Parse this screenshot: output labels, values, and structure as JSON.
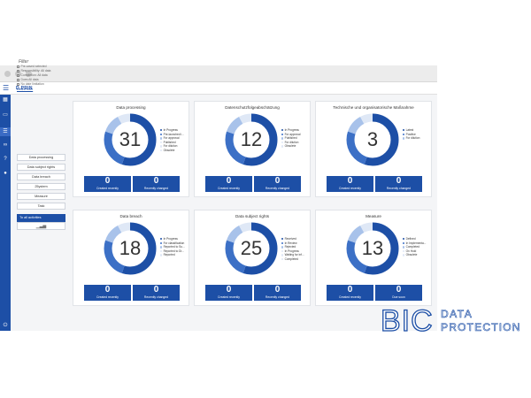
{
  "app": {
    "brand": "D.PRIN"
  },
  "colors": {
    "primary": "#1d4fa6",
    "mid": "#3c70c6",
    "light": "#a8c2ea",
    "pale": "#dfe8f6"
  },
  "sidebar": {
    "icons": [
      "grid-icon",
      "bar-chart-icon",
      "list-icon",
      "share-icon",
      "help-icon",
      "user-icon",
      "power-icon"
    ]
  },
  "filter": {
    "title": "Filter",
    "options": [
      "Pre-saved selected",
      "Responsibility: All data",
      "Completion: All data",
      "Does All data",
      "No date limitation"
    ],
    "define_link": "Define filter"
  },
  "categories": [
    "Data processing",
    "Data subject rights",
    "Data breach",
    "25ystem",
    "Measure",
    "Task"
  ],
  "all_activities": "To all activities",
  "cards": [
    {
      "title": "Data processing",
      "count": "31",
      "legend": [
        "In Progress",
        "Pre-launched i...",
        "For approval",
        "Published",
        "For dilution",
        "Obsolete"
      ],
      "created_value": "0",
      "created_label": "Created recently",
      "second_value": "0",
      "second_label": "Recently changed"
    },
    {
      "title": "Datenschutzfolgeabschätzung",
      "count": "12",
      "legend": [
        "In Progress",
        "For approval",
        "Published",
        "For dilution",
        "Obsolete"
      ],
      "created_value": "0",
      "created_label": "Created recently",
      "second_value": "0",
      "second_label": "Recently changed"
    },
    {
      "title": "Technische und organisatorische Maßnahme",
      "count": "3",
      "legend": [
        "Latest",
        "Positive",
        "For dilution"
      ],
      "created_value": "0",
      "created_label": "Created recently",
      "second_value": "0",
      "second_label": "Recently changed"
    },
    {
      "title": "Data breach",
      "count": "18",
      "legend": [
        "In Progress",
        "For classification",
        "Reported to Su...",
        "Reported to Di...",
        "Reported"
      ],
      "created_value": "0",
      "created_label": "Created recently",
      "second_value": "0",
      "second_label": "Recently changed"
    },
    {
      "title": "Data subject rights",
      "count": "25",
      "legend": [
        "Received",
        "In Review",
        "Rejected",
        "In Progress",
        "Waiting for inf...",
        "Completed"
      ],
      "created_value": "0",
      "created_label": "Created recently",
      "second_value": "0",
      "second_label": "Recently changed"
    },
    {
      "title": "Measure",
      "count": "13",
      "legend": [
        "Defined",
        "In Implementa...",
        "Completed",
        "On Hold",
        "Obsolete"
      ],
      "created_value": "0",
      "created_label": "Created recently",
      "second_value": "0",
      "second_label": "Due soon"
    }
  ],
  "logo": {
    "bic": "BIC",
    "line1": "DATA",
    "line2": "PROTECTION"
  }
}
